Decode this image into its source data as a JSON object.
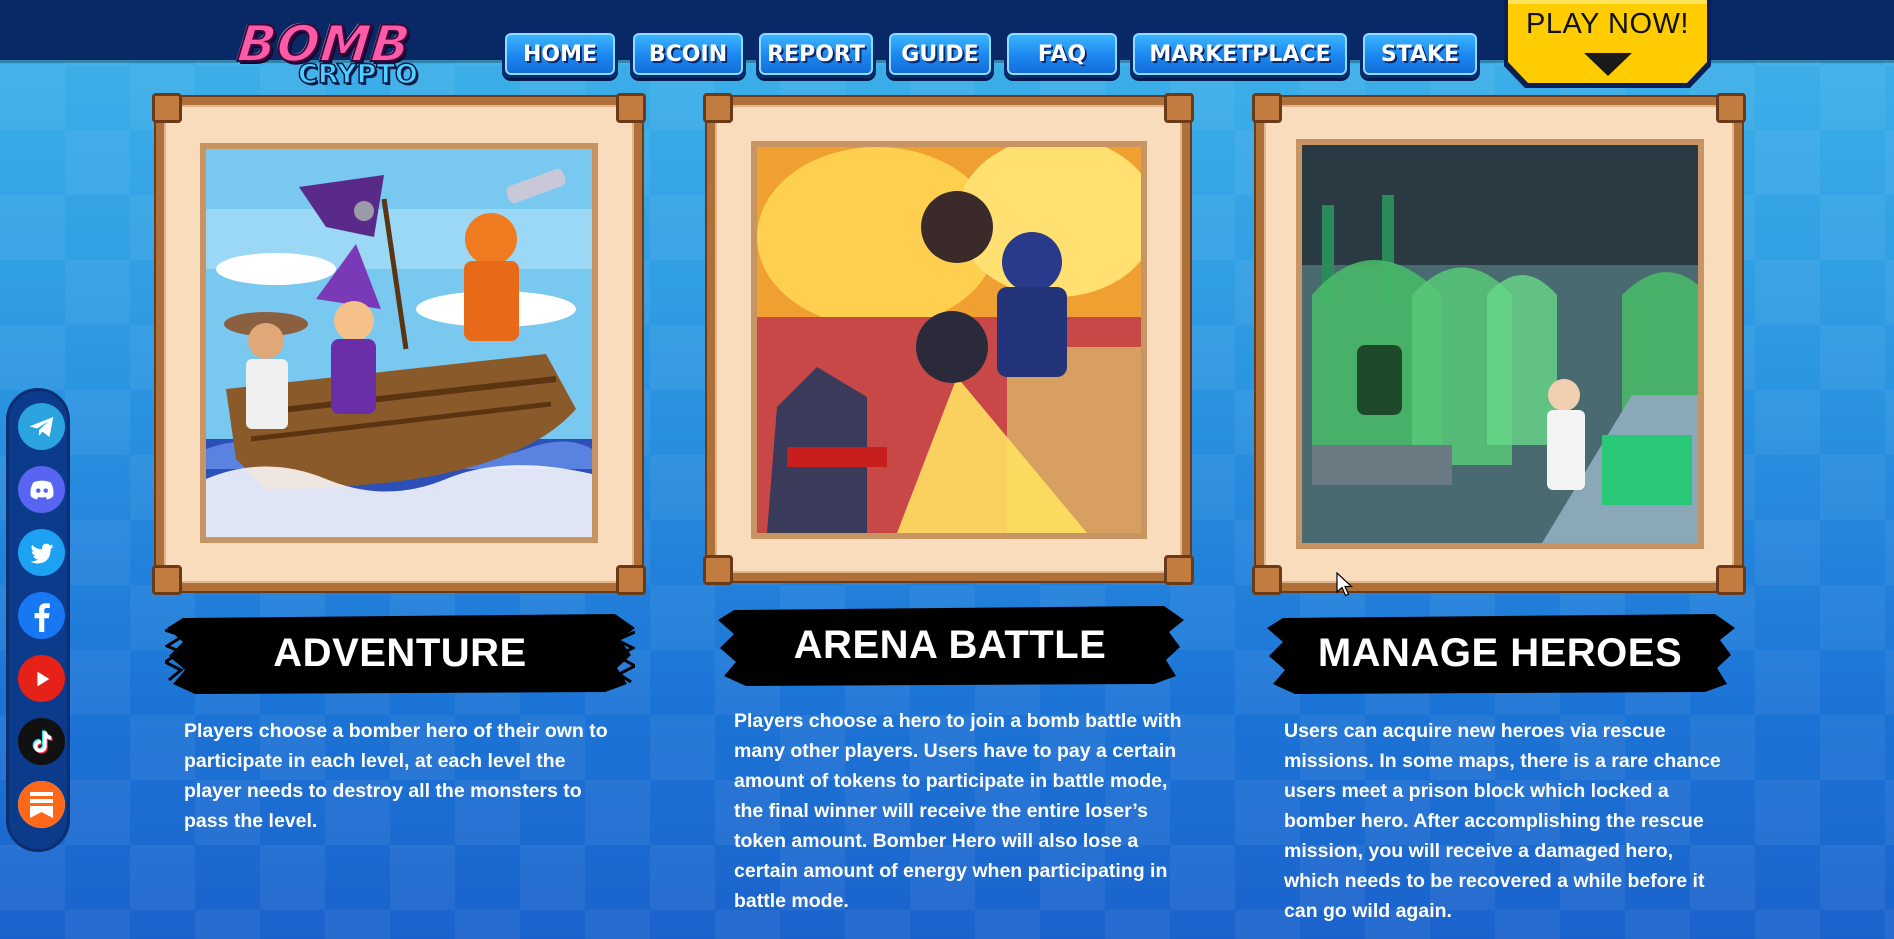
{
  "logo": {
    "main": "BOMB",
    "sub": "CRYPTO",
    "icon": "bombcrypto-logo"
  },
  "nav": {
    "items": [
      {
        "label": "HOME"
      },
      {
        "label": "BCOIN"
      },
      {
        "label": "REPORT"
      },
      {
        "label": "GUIDE"
      },
      {
        "label": "FAQ"
      },
      {
        "label": "MARKETPLACE"
      },
      {
        "label": "STAKE"
      }
    ],
    "play_now": "PLAY NOW!"
  },
  "social": [
    {
      "icon": "telegram-icon",
      "color": "#2aa3df"
    },
    {
      "icon": "discord-icon",
      "color": "#5865f2"
    },
    {
      "icon": "twitter-icon",
      "color": "#1da1f2"
    },
    {
      "icon": "facebook-icon",
      "color": "#1877f2"
    },
    {
      "icon": "youtube-icon",
      "color": "#e62117"
    },
    {
      "icon": "tiktok-icon",
      "color": "#111111"
    },
    {
      "icon": "substack-icon",
      "color": "#ff6719"
    }
  ],
  "cards": [
    {
      "title": "ADVENTURE",
      "description": "Players choose a bomber hero of their own to participate in each level, at each level the player needs to destroy all the monsters to pass the level."
    },
    {
      "title": "ARENA BATTLE",
      "description": "Players choose a hero to join a bomb battle with many other players. Users have to pay a certain amount of tokens to participate in battle mode, the final winner will receive the entire loser’s token amount. Bomber Hero will also lose a certain amount of energy when participating in battle mode."
    },
    {
      "title": "MANAGE HEROES",
      "description": "Users can acquire new heroes via rescue missions. In some maps, there is a rare chance users meet a prison block which locked a bomber hero. After accomplishing the rescue mission, you will receive a damaged hero, which needs to be recovered a while before it can go wild again."
    }
  ],
  "colors": {
    "topbar": "#082866",
    "nav_button": "#1b86f0",
    "play_button": "#ffcc00",
    "frame": "#b0703a",
    "frame_fill": "#f8dcbc",
    "banner": "#000000"
  }
}
